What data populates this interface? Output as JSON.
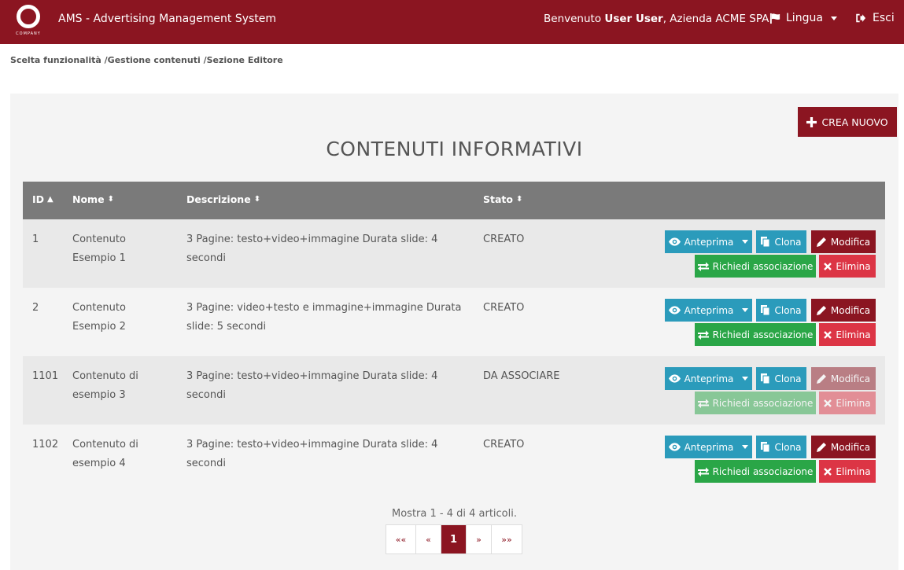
{
  "header": {
    "logo_text": "COMPANY",
    "app_title": "AMS - Advertising Management System",
    "welcome_prefix": "Benvenuto",
    "user_name": "User User",
    "company_text": ", Azienda ACME SPA",
    "language_label": "Lingua",
    "exit_label": "Esci"
  },
  "breadcrumb": {
    "text": "Scelta funzionalità /Gestione contenuti /Sezione Editore"
  },
  "panel": {
    "create_label": "CREA NUOVO",
    "title": "CONTENUTI INFORMATIVI"
  },
  "table": {
    "headers": {
      "id": "ID",
      "name": "Nome",
      "description": "Descrizione",
      "state": "Stato"
    },
    "action_labels": {
      "preview": "Anteprima",
      "clone": "Clona",
      "edit": "Modifica",
      "request_association": "Richiedi associazione",
      "delete": "Elimina"
    },
    "rows": [
      {
        "id": "1",
        "name": "Contenuto Esempio 1",
        "description": "3 Pagine: testo+video+immagine Durata slide: 4 secondi",
        "state": "CREATO"
      },
      {
        "id": "2",
        "name": "Contenuto Esempio 2",
        "description": "3 Pagine: video+testo e immagine+immagine Durata slide: 5 secondi",
        "state": "CREATO"
      },
      {
        "id": "1101",
        "name": "Contenuto di esempio 3",
        "description": "3 Pagine: testo+video+immagine Durata slide: 4 secondi",
        "state": "DA ASSOCIARE"
      },
      {
        "id": "1102",
        "name": "Contenuto di esempio 4",
        "description": "3 Pagine: testo+video+immagine Durata slide: 4 secondi",
        "state": "CREATO"
      }
    ]
  },
  "pagination": {
    "summary": "Mostra 1 - 4 di 4 articoli.",
    "first": "««",
    "prev": "«",
    "current": "1",
    "next": "»",
    "last": "»»"
  },
  "colors": {
    "brand": "#8b1521",
    "info": "#2b9bbb",
    "success": "#2aa647",
    "danger": "#dc3545",
    "table_header": "#7a7a7a"
  }
}
